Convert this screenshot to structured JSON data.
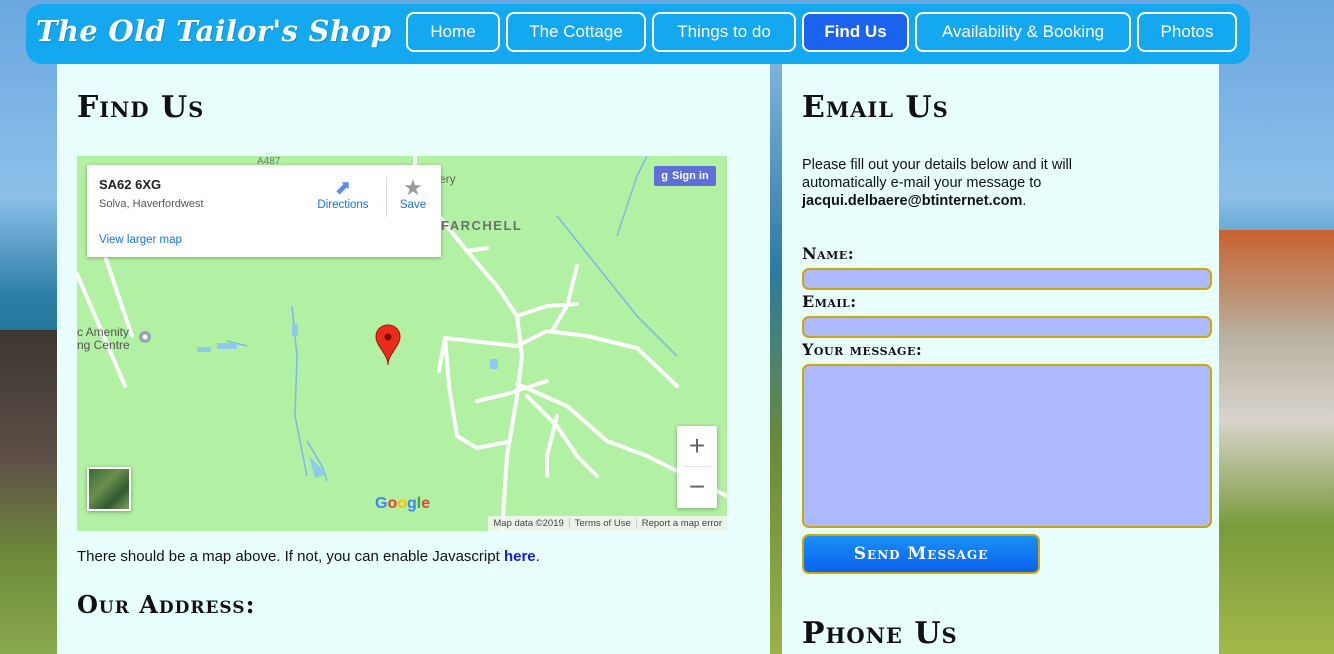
{
  "site": {
    "title": "The Old Tailor's Shop"
  },
  "nav": {
    "items": [
      {
        "label": "Home",
        "active": false
      },
      {
        "label": "The Cottage",
        "active": false
      },
      {
        "label": "Things to do",
        "active": false
      },
      {
        "label": "Find Us",
        "active": true
      },
      {
        "label": "Availability & Booking",
        "active": false
      },
      {
        "label": "Photos",
        "active": false
      }
    ]
  },
  "find_us": {
    "title": "Find Us",
    "map": {
      "place_title": "SA62 6XG",
      "place_subtitle": "Solva, Haverfordwest",
      "directions_label": "Directions",
      "save_label": "Save",
      "view_larger": "View larger map",
      "signin_label": "Sign in",
      "label_farchell": "FARCHELL",
      "label_ery": "ery",
      "label_road": "A487",
      "label_amenity_line1": "c Amenity",
      "label_amenity_line2": "ng Centre",
      "zoom_in": "+",
      "zoom_out": "−",
      "google_logo": "Google",
      "footer": [
        "Map data ©2019",
        "Terms of Use",
        "Report a map error"
      ]
    },
    "note_prefix": "There should be a map above. If not, you can enable Javascript ",
    "note_link": "here",
    "note_suffix": ".",
    "address_title": "Our Address:"
  },
  "email_us": {
    "title": "Email Us",
    "intro_text": "Please fill out your details below and it will automatically e-mail your message to ",
    "email": "jacqui.delbaere@btinternet.com",
    "intro_suffix": ".",
    "name_label": "Name:",
    "email_label": "Email:",
    "message_label": "Your message:",
    "name_value": "",
    "email_value": "",
    "message_value": "",
    "send_label": "Send Message"
  },
  "phone_us": {
    "title": "Phone Us"
  },
  "colors": {
    "header": "#13a8f0",
    "nav_active": "#1b62ee",
    "panel_bg": "#e9fffe",
    "field_bg": "#adbaff",
    "field_border": "#c9a80c",
    "map_green": "#b2f0a3"
  }
}
